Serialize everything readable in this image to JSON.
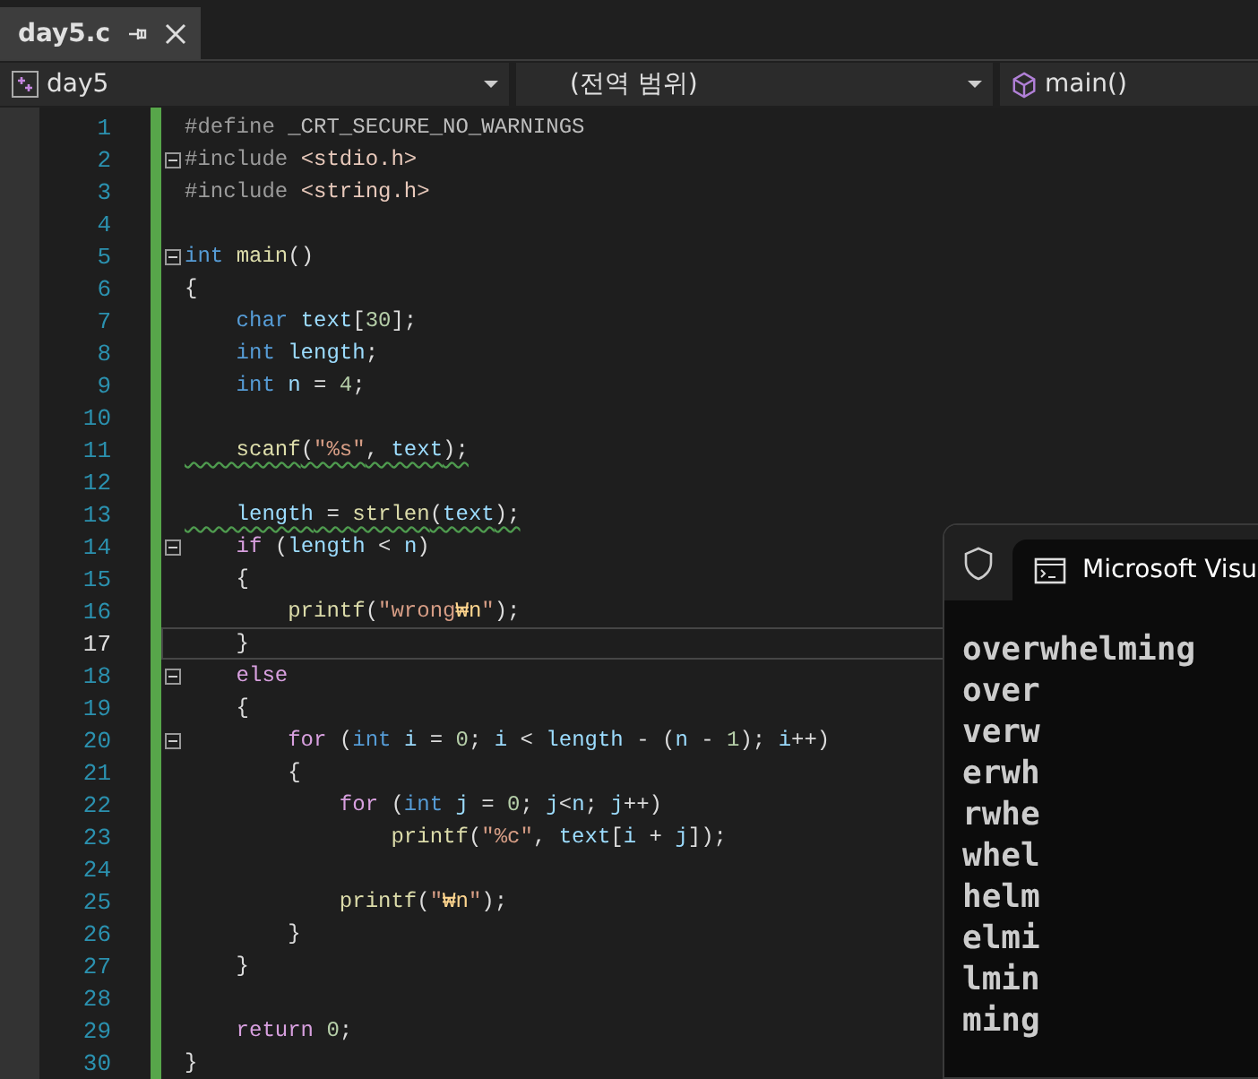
{
  "file_tab": {
    "title": "day5.c",
    "selected": true
  },
  "nav": {
    "project": "day5",
    "scope": "(전역 범위)",
    "member": "main()"
  },
  "lines": [
    {
      "number": "1",
      "tokens": [
        {
          "kind": "pre",
          "text": "#define "
        },
        {
          "kind": "mac",
          "text": "_CRT_SECURE_NO_WARNINGS"
        }
      ]
    },
    {
      "number": "2",
      "collapsible": true,
      "tokens": [
        {
          "kind": "pre",
          "text": "#include "
        },
        {
          "kind": "inc",
          "text": "<stdio.h>"
        }
      ]
    },
    {
      "number": "3",
      "tokens": [
        {
          "kind": "pre",
          "text": "#include "
        },
        {
          "kind": "inc",
          "text": "<string.h>"
        }
      ]
    },
    {
      "number": "4"
    },
    {
      "number": "5",
      "collapsible": true,
      "tokens": [
        {
          "kind": "kw",
          "text": "int "
        },
        {
          "kind": "fn",
          "text": "main"
        },
        {
          "kind": "p",
          "text": "()"
        }
      ]
    },
    {
      "number": "6",
      "tokens": [
        {
          "kind": "p",
          "text": "{"
        }
      ]
    },
    {
      "number": "7",
      "tokens": [
        {
          "kind": "kw",
          "text": "    char "
        },
        {
          "kind": "var",
          "text": "text"
        },
        {
          "kind": "p",
          "text": "["
        },
        {
          "kind": "num",
          "text": "30"
        },
        {
          "kind": "p",
          "text": "];"
        }
      ]
    },
    {
      "number": "8",
      "tokens": [
        {
          "kind": "kw",
          "text": "    int "
        },
        {
          "kind": "var",
          "text": "length"
        },
        {
          "kind": "p",
          "text": ";"
        }
      ]
    },
    {
      "number": "9",
      "tokens": [
        {
          "kind": "kw",
          "text": "    int "
        },
        {
          "kind": "var",
          "text": "n"
        },
        {
          "kind": "p",
          "text": " = "
        },
        {
          "kind": "num",
          "text": "4"
        },
        {
          "kind": "p",
          "text": ";"
        }
      ]
    },
    {
      "number": "10"
    },
    {
      "number": "11",
      "warning": true,
      "tokens": [
        {
          "kind": "fn",
          "text": "    scanf"
        },
        {
          "kind": "p",
          "text": "("
        },
        {
          "kind": "str",
          "text": "\"%s\""
        },
        {
          "kind": "p",
          "text": ", "
        },
        {
          "kind": "var",
          "text": "text"
        },
        {
          "kind": "p",
          "text": ");"
        }
      ]
    },
    {
      "number": "12"
    },
    {
      "number": "13",
      "warning": true,
      "tokens": [
        {
          "kind": "var",
          "text": "    length"
        },
        {
          "kind": "p",
          "text": " = "
        },
        {
          "kind": "fn",
          "text": "strlen"
        },
        {
          "kind": "p",
          "text": "("
        },
        {
          "kind": "var",
          "text": "text"
        },
        {
          "kind": "p",
          "text": ");"
        }
      ]
    },
    {
      "number": "14",
      "collapsible": true,
      "tokens": [
        {
          "kind": "ctl",
          "text": "    if "
        },
        {
          "kind": "p",
          "text": "("
        },
        {
          "kind": "var",
          "text": "length"
        },
        {
          "kind": "p",
          "text": " < "
        },
        {
          "kind": "var",
          "text": "n"
        },
        {
          "kind": "p",
          "text": ")"
        }
      ]
    },
    {
      "number": "15",
      "tokens": [
        {
          "kind": "p",
          "text": "    {"
        }
      ]
    },
    {
      "number": "16",
      "tokens": [
        {
          "kind": "fn",
          "text": "        printf"
        },
        {
          "kind": "p",
          "text": "("
        },
        {
          "kind": "str",
          "text": "\"wrong"
        },
        {
          "kind": "esc",
          "text": "₩n"
        },
        {
          "kind": "str",
          "text": "\""
        },
        {
          "kind": "p",
          "text": ");"
        }
      ]
    },
    {
      "number": "17",
      "current": true,
      "tokens": [
        {
          "kind": "p",
          "text": "    }"
        }
      ]
    },
    {
      "number": "18",
      "collapsible": true,
      "tokens": [
        {
          "kind": "ctl",
          "text": "    else"
        }
      ]
    },
    {
      "number": "19",
      "tokens": [
        {
          "kind": "p",
          "text": "    {"
        }
      ]
    },
    {
      "number": "20",
      "collapsible": true,
      "tokens": [
        {
          "kind": "ctl",
          "text": "        for "
        },
        {
          "kind": "p",
          "text": "("
        },
        {
          "kind": "kw",
          "text": "int "
        },
        {
          "kind": "var",
          "text": "i"
        },
        {
          "kind": "p",
          "text": " = "
        },
        {
          "kind": "num",
          "text": "0"
        },
        {
          "kind": "p",
          "text": "; "
        },
        {
          "kind": "var",
          "text": "i"
        },
        {
          "kind": "p",
          "text": " < "
        },
        {
          "kind": "var",
          "text": "length"
        },
        {
          "kind": "p",
          "text": " - ("
        },
        {
          "kind": "var",
          "text": "n"
        },
        {
          "kind": "p",
          "text": " - "
        },
        {
          "kind": "num",
          "text": "1"
        },
        {
          "kind": "p",
          "text": "); "
        },
        {
          "kind": "var",
          "text": "i"
        },
        {
          "kind": "p",
          "text": "++)"
        }
      ]
    },
    {
      "number": "21",
      "tokens": [
        {
          "kind": "p",
          "text": "        {"
        }
      ]
    },
    {
      "number": "22",
      "tokens": [
        {
          "kind": "ctl",
          "text": "            for "
        },
        {
          "kind": "p",
          "text": "("
        },
        {
          "kind": "kw",
          "text": "int "
        },
        {
          "kind": "var",
          "text": "j"
        },
        {
          "kind": "p",
          "text": " = "
        },
        {
          "kind": "num",
          "text": "0"
        },
        {
          "kind": "p",
          "text": "; "
        },
        {
          "kind": "var",
          "text": "j"
        },
        {
          "kind": "p",
          "text": "<"
        },
        {
          "kind": "var",
          "text": "n"
        },
        {
          "kind": "p",
          "text": "; "
        },
        {
          "kind": "var",
          "text": "j"
        },
        {
          "kind": "p",
          "text": "++)"
        }
      ]
    },
    {
      "number": "23",
      "tokens": [
        {
          "kind": "fn",
          "text": "                printf"
        },
        {
          "kind": "p",
          "text": "("
        },
        {
          "kind": "str",
          "text": "\"%c\""
        },
        {
          "kind": "p",
          "text": ", "
        },
        {
          "kind": "var",
          "text": "text"
        },
        {
          "kind": "p",
          "text": "["
        },
        {
          "kind": "var",
          "text": "i"
        },
        {
          "kind": "p",
          "text": " + "
        },
        {
          "kind": "var",
          "text": "j"
        },
        {
          "kind": "p",
          "text": "]);"
        }
      ]
    },
    {
      "number": "24"
    },
    {
      "number": "25",
      "tokens": [
        {
          "kind": "fn",
          "text": "            printf"
        },
        {
          "kind": "p",
          "text": "("
        },
        {
          "kind": "str",
          "text": "\""
        },
        {
          "kind": "esc",
          "text": "₩n"
        },
        {
          "kind": "str",
          "text": "\""
        },
        {
          "kind": "p",
          "text": ");"
        }
      ]
    },
    {
      "number": "26",
      "tokens": [
        {
          "kind": "p",
          "text": "        }"
        }
      ]
    },
    {
      "number": "27",
      "tokens": [
        {
          "kind": "p",
          "text": "    }"
        }
      ]
    },
    {
      "number": "28"
    },
    {
      "number": "29",
      "tokens": [
        {
          "kind": "ctl",
          "text": "    return "
        },
        {
          "kind": "num",
          "text": "0"
        },
        {
          "kind": "p",
          "text": ";"
        }
      ]
    },
    {
      "number": "30",
      "tokens": [
        {
          "kind": "p",
          "text": "}"
        }
      ]
    }
  ],
  "console": {
    "tab_title": "Microsoft Visu",
    "output": [
      "overwhelming",
      "over",
      "verw",
      "erwh",
      "rwhe",
      "whel",
      "helm",
      "elmi",
      "lmin",
      "ming"
    ]
  }
}
